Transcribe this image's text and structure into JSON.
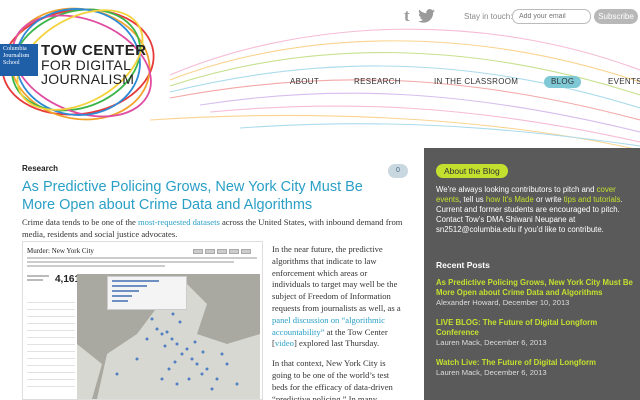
{
  "header": {
    "badge_text": "Columbia Journalism School",
    "org_line1": "TOW CENTER",
    "org_line2": "FOR DIGITAL",
    "org_line3": "JOURNALISM",
    "social_icons": [
      "tumblr-icon",
      "twitter-icon"
    ],
    "stay_label": "Stay in touch:",
    "email_placeholder": "Add your email",
    "subscribe_label": "Subscribe"
  },
  "nav": {
    "items": [
      "ABOUT",
      "RESEARCH",
      "IN THE CLASSROOM",
      "BLOG",
      "EVENTS"
    ],
    "active": "BLOG"
  },
  "article": {
    "category": "Research",
    "comment_count": "0",
    "title": "As Predictive Policing Grows, New York City Must Be More Open about Crime Data and Algorithms",
    "intro_before": "Crime data tends to be one of the ",
    "intro_link": "most-requested datasets",
    "intro_after": " across the United States, with inbound demand from media, residents and social justice advocates.",
    "embed_title": "Murder: New York City",
    "embed_count": "4,161",
    "p1_before": "In the near future, the predictive algorithms that indicate to law enforcement which areas or individuals to target may well be the subject of Freedom of Information requests from journalists as well, as a ",
    "p1_link": "panel discussion on “algorithmic accountability”",
    "p1_mid": " at the Tow Center [",
    "p1_video": "video",
    "p1_after": "] explored last Thursday.",
    "p2": "In that context, New York City is going to be one of the world’s test beds for the efficacy of data-driven “predictive policing.” In many"
  },
  "sidebar": {
    "about_label": "About the Blog",
    "about_t1": "We’re always looking contributors to pitch and ",
    "about_l1": "cover events",
    "about_t2": ", tell us ",
    "about_l2": "how It’s Made",
    "about_t3": " or write ",
    "about_l3": "tips and tutorials",
    "about_t4": ". Current and former students are encouraged to pitch. Contact Tow’s DMA Shiwani Neupane at sn2512@columbia.edu if you’d like to contribute.",
    "recent_heading": "Recent Posts",
    "recent_posts": [
      {
        "title": "As Predictive Policing Grows, New York City Must Be More Open about Crime Data and Algorithms",
        "meta": "Alexander Howard, December 10, 2013"
      },
      {
        "title": "LIVE BLOG: The Future of Digital Longform Conference",
        "meta": "Lauren Mack, December 6, 2013"
      },
      {
        "title": "Watch Live: The Future of Digital Longform",
        "meta": "Lauren Mack, December 6, 2013"
      }
    ]
  },
  "colors": {
    "link_blue": "#2a9fc6",
    "accent_green": "#c4e02e",
    "nav_active": "#7fc9d6",
    "sidebar_bg": "#5a5a5a",
    "badge_blue": "#1f5fa8"
  }
}
